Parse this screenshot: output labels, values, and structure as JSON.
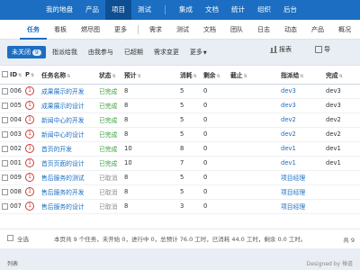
{
  "topnav": {
    "items": [
      {
        "label": "我的地盘",
        "active": false
      },
      {
        "label": "产品",
        "active": false
      },
      {
        "label": "项目",
        "active": true
      },
      {
        "label": "测试",
        "active": false
      },
      {
        "label": "集成",
        "active": false
      },
      {
        "label": "文档",
        "active": false
      },
      {
        "label": "统计",
        "active": false
      },
      {
        "label": "组织",
        "active": false
      },
      {
        "label": "后台",
        "active": false
      }
    ]
  },
  "subnav": {
    "items": [
      {
        "label": "任务",
        "active": true
      },
      {
        "label": "看板",
        "active": false
      },
      {
        "label": "燃尽图",
        "active": false
      },
      {
        "label": "更多",
        "active": false
      },
      {
        "label": "需求",
        "active": false
      },
      {
        "label": "测试",
        "active": false
      },
      {
        "label": "文档",
        "active": false
      },
      {
        "label": "团队",
        "active": false
      },
      {
        "label": "日志",
        "active": false
      },
      {
        "label": "动态",
        "active": false
      },
      {
        "label": "产品",
        "active": false
      },
      {
        "label": "概况",
        "active": false
      }
    ]
  },
  "filters": {
    "items": [
      {
        "label": "未关闭",
        "badge": "9",
        "active": true
      },
      {
        "label": "指派给我",
        "active": false
      },
      {
        "label": "由我参与",
        "active": false
      },
      {
        "label": "已超期",
        "active": false
      },
      {
        "label": "需求变更",
        "active": false
      },
      {
        "label": "更多",
        "active": false
      }
    ],
    "export_label": "报表",
    "extra_label": "导"
  },
  "table": {
    "headers": [
      "ID",
      "P",
      "任务名称",
      "状态",
      "预计",
      "消耗",
      "剩余",
      "截止",
      "指派给",
      "完成"
    ],
    "rows": [
      {
        "id": "006",
        "pri": "1",
        "name": "成果展示的开发",
        "status": "已完成",
        "status_type": "done",
        "est": "8",
        "consumed": "5",
        "left": "0",
        "deadline": "",
        "assigned": "dev3",
        "finished": "dev3"
      },
      {
        "id": "005",
        "pri": "1",
        "name": "成果展示的设计",
        "status": "已完成",
        "status_type": "done",
        "est": "8",
        "consumed": "5",
        "left": "0",
        "deadline": "",
        "assigned": "dev3",
        "finished": "dev3"
      },
      {
        "id": "004",
        "pri": "1",
        "name": "新闻中心的开发",
        "status": "已完成",
        "status_type": "done",
        "est": "8",
        "consumed": "5",
        "left": "0",
        "deadline": "",
        "assigned": "dev2",
        "finished": "dev2"
      },
      {
        "id": "003",
        "pri": "1",
        "name": "新闻中心的设计",
        "status": "已完成",
        "status_type": "done",
        "est": "8",
        "consumed": "5",
        "left": "0",
        "deadline": "",
        "assigned": "dev2",
        "finished": "dev2"
      },
      {
        "id": "002",
        "pri": "1",
        "name": "首页的开发",
        "status": "已完成",
        "status_type": "done",
        "est": "10",
        "consumed": "8",
        "left": "0",
        "deadline": "",
        "assigned": "dev1",
        "finished": "dev1"
      },
      {
        "id": "001",
        "pri": "1",
        "name": "首页页面的设计",
        "status": "已完成",
        "status_type": "done",
        "est": "10",
        "consumed": "7",
        "left": "0",
        "deadline": "",
        "assigned": "dev1",
        "finished": "dev1"
      },
      {
        "id": "009",
        "pri": "1",
        "name": "售后服务的测试",
        "status": "已取消",
        "status_type": "cancel",
        "est": "8",
        "consumed": "5",
        "left": "0",
        "deadline": "",
        "assigned": "项目经理",
        "finished": ""
      },
      {
        "id": "008",
        "pri": "1",
        "name": "售后服务的开发",
        "status": "已取消",
        "status_type": "cancel",
        "est": "8",
        "consumed": "5",
        "left": "0",
        "deadline": "",
        "assigned": "项目经理",
        "finished": ""
      },
      {
        "id": "007",
        "pri": "1",
        "name": "售后服务的设计",
        "status": "已取消",
        "status_type": "cancel",
        "est": "8",
        "consumed": "3",
        "left": "0",
        "deadline": "",
        "assigned": "项目经理",
        "finished": ""
      }
    ]
  },
  "footer": {
    "select_all": "全选",
    "summary": "本页共 9 个任务，未开始 0，进行中 0，总预计 76.0 工时，已消耗 44.0 工时，剩余 0.0 工时。",
    "pager": "共 9"
  },
  "bottom": {
    "left": "列表",
    "right": "Designed by 禅道"
  },
  "colors": {
    "primary": "#1b6ec2",
    "done": "#3a9e3a",
    "priority": "#d03c3c"
  }
}
